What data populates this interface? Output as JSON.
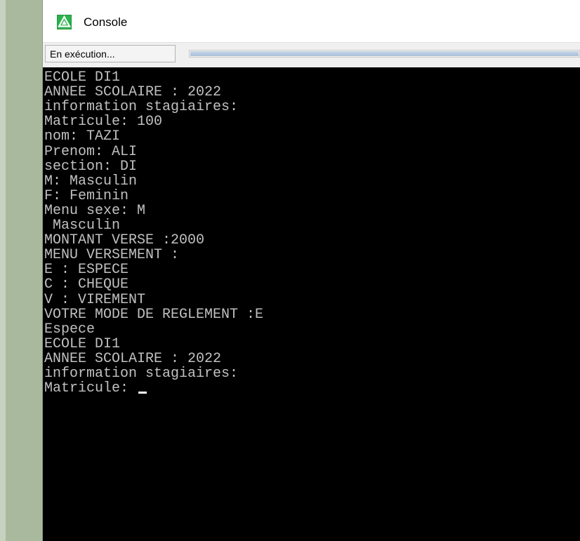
{
  "window": {
    "title": "Console",
    "icon": "recycle-triangle-icon",
    "accent_color": "#2bb24c"
  },
  "status": {
    "text": "En exécution...",
    "progress_fraction": 1.0
  },
  "console": {
    "background": "#000000",
    "text_color": "#c0c0c0",
    "lines": [
      "ECOLE DI1",
      "ANNEE SCOLAIRE : 2022",
      "information stagiaires:",
      "Matricule: 100",
      "nom: TAZI",
      "Prenom: ALI",
      "section: DI",
      "M: Masculin",
      "F: Feminin",
      "Menu sexe: M",
      " Masculin",
      "MONTANT VERSE :2000",
      "MENU VERSEMENT :",
      "E : ESPECE",
      "C : CHEQUE",
      "V : VIREMENT",
      "VOTRE MODE DE REGLEMENT :E",
      "Espece",
      "ECOLE DI1",
      "ANNEE SCOLAIRE : 2022",
      "information stagiaires:",
      "Matricule: "
    ]
  }
}
